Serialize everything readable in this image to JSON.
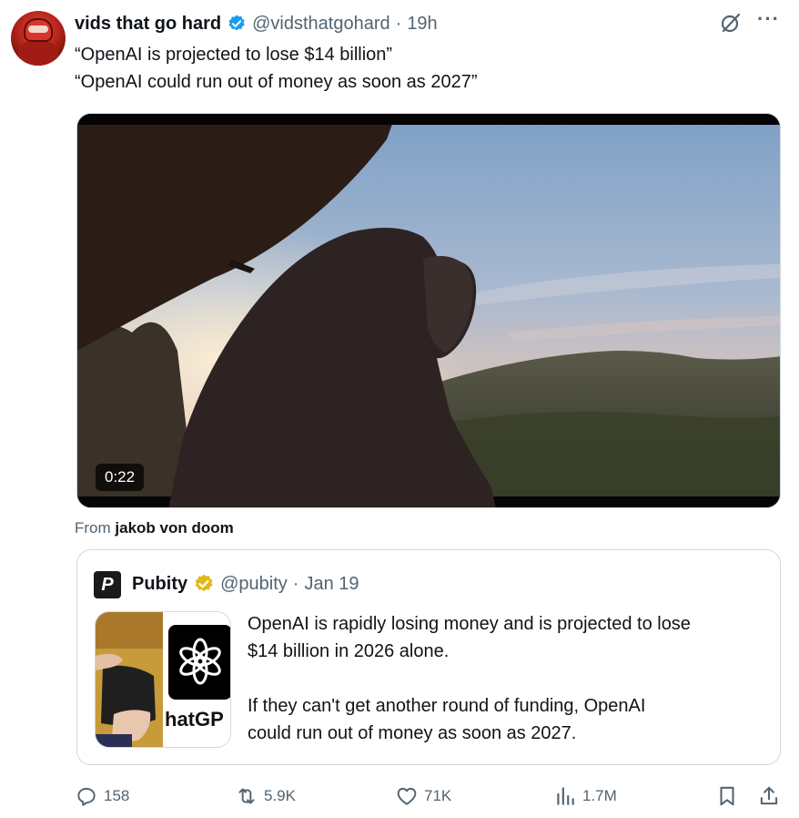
{
  "author": {
    "display_name": "vids that go hard",
    "handle": "@vidsthatgohard",
    "separator": "·",
    "time": "19h"
  },
  "tweet": {
    "lines": [
      "“OpenAI is projected to lose $14 billion”",
      "“OpenAI could run out of money as soon as 2027”"
    ]
  },
  "media": {
    "duration": "0:22",
    "from_prefix": "From",
    "from_name": "jakob von doom"
  },
  "quote": {
    "avatar_letter": "P",
    "display_name": "Pubity",
    "handle": "@pubity",
    "separator": "·",
    "date": "Jan 19",
    "thumbnail_text": "hatGP",
    "paragraph_1_lines": [
      "OpenAI is rapidly losing money and is projected to lose",
      "$14 billion in 2026 alone."
    ],
    "paragraph_2_lines": [
      "If they can't get another round of funding, OpenAI",
      "could run out of money as soon as 2027."
    ]
  },
  "actions": {
    "replies": "158",
    "reposts": "5.9K",
    "likes": "71K",
    "views": "1.7M"
  },
  "colors": {
    "verified_blue": "#1d9bf0",
    "verified_gold": "#e2b719",
    "secondary_text": "#536471",
    "border": "#cfd9de"
  },
  "icons": [
    "verified-badge-icon",
    "grok-icon",
    "more-icon",
    "reply-icon",
    "repost-icon",
    "like-icon",
    "views-icon",
    "bookmark-icon",
    "share-icon"
  ]
}
